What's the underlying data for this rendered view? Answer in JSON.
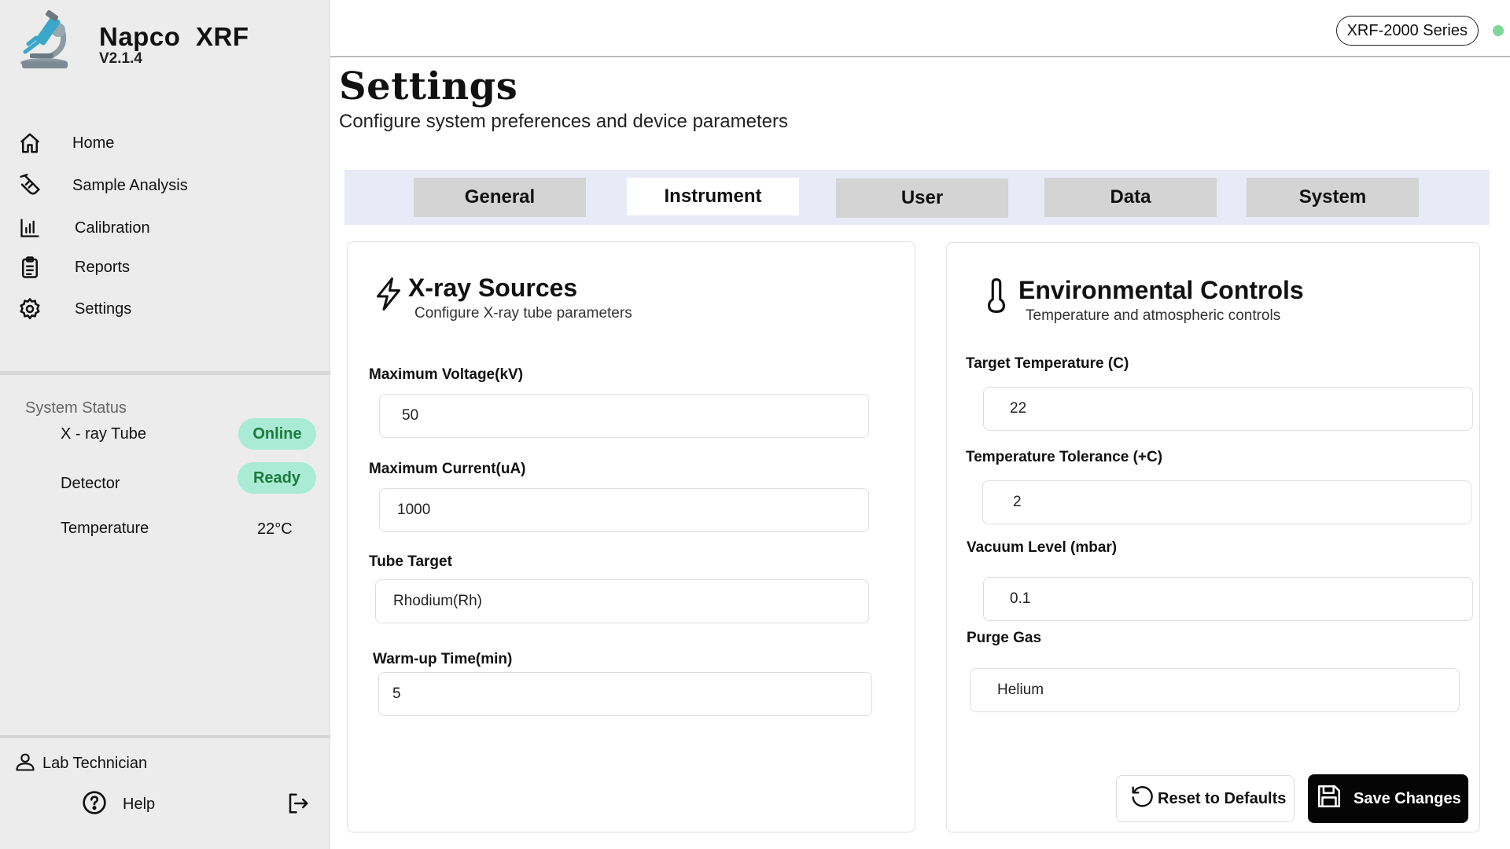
{
  "app": {
    "name": "Napco  XRF",
    "version": "V2.1.4"
  },
  "nav": [
    {
      "label": "Home",
      "icon": "home-icon"
    },
    {
      "label": "Sample Analysis",
      "icon": "test-tube-icon"
    },
    {
      "label": "Calibration",
      "icon": "bar-chart-icon"
    },
    {
      "label": "Reports",
      "icon": "clipboard-icon"
    },
    {
      "label": "Settings",
      "icon": "gear-icon"
    }
  ],
  "system_status": {
    "title": "System Status",
    "xray_tube": {
      "label": "X - ray Tube",
      "value": "Online"
    },
    "detector": {
      "label": "Detector",
      "value": "Ready"
    },
    "temperature": {
      "label": "Temperature",
      "value": "22°C"
    }
  },
  "user": {
    "name": "Lab Technician",
    "help": "Help"
  },
  "header": {
    "series": "XRF-2000 Series"
  },
  "page": {
    "title": "Settings",
    "subtitle": "Configure system preferences and device parameters"
  },
  "tabs": [
    {
      "label": "General"
    },
    {
      "label": "Instrument",
      "active": true
    },
    {
      "label": "User"
    },
    {
      "label": "Data"
    },
    {
      "label": "System"
    }
  ],
  "xray": {
    "title": "X-ray Sources",
    "subtitle": "Configure X-ray tube parameters",
    "max_voltage": {
      "label": "Maximum Voltage(kV)",
      "value": "50"
    },
    "max_current": {
      "label": "Maximum Current(uA)",
      "value": "1000"
    },
    "tube_target": {
      "label": "Tube Target",
      "value": "Rhodium(Rh)"
    },
    "warmup": {
      "label": "Warm-up Time(min)",
      "value": "5"
    }
  },
  "env": {
    "title": "Environmental Controls",
    "subtitle": "Temperature and atmospheric controls",
    "target_temp": {
      "label": "Target Temperature (C)",
      "value": "22"
    },
    "temp_tolerance": {
      "label": "Temperature Tolerance (+C)",
      "value": "2"
    },
    "vacuum": {
      "label": "Vacuum Level (mbar)",
      "value": "0.1"
    },
    "purge_gas": {
      "label": "Purge Gas",
      "value": "Helium"
    }
  },
  "actions": {
    "reset": "Reset to Defaults",
    "save": "Save Changes"
  },
  "colors": {
    "status_badge_bg": "#a9ebd5",
    "status_badge_text": "#1d7a3c",
    "online_dot": "#7fd89a",
    "tab_bar_bg": "#e8eaf7",
    "save_button_bg": "#050505"
  }
}
